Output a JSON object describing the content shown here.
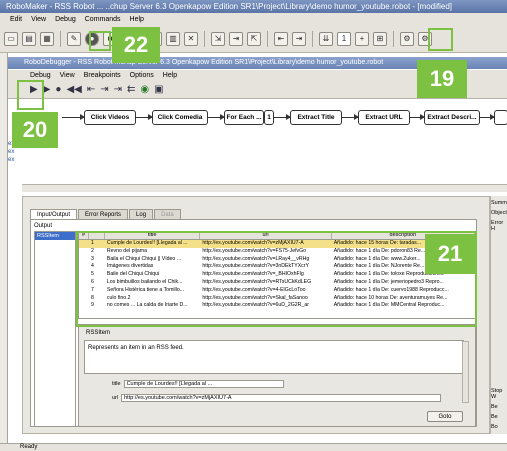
{
  "window": {
    "title": "RoboMaker - RSS Robot ...  ..chup Server 6.3 Openkapow Edition SR1\\Project\\Library\\demo  humor_youtube.robot  - [modified]"
  },
  "menu": [
    "Edit",
    "View",
    "Debug",
    "Commands",
    "Help"
  ],
  "debugger": {
    "title": "RoboDebugger - RSS Robot ...chup Server 6.3 Openkapow Edition SR1\\Project\\Library\\demo  humor_youtube.robot",
    "menu": [
      "Debug",
      "View",
      "Breakpoints",
      "Options",
      "Help"
    ]
  },
  "flow_steps": [
    "Click Videos",
    "Click Comedia",
    "For Each ...",
    "1",
    "Extract Title",
    "Extract URL",
    "Extract Descri..."
  ],
  "callouts": {
    "c19": "19",
    "c20": "20",
    "c21": "21",
    "c22": "22"
  },
  "accent_color": "#7dc142",
  "left_strip_text": [
    "ex.",
    "ex",
    "ex"
  ],
  "tabs": [
    "Input/Output",
    "Error Reports",
    "Log",
    "Data"
  ],
  "output": {
    "label": "Output",
    "list": [
      "RSSItem"
    ]
  },
  "table": {
    "columns": [
      "#",
      "title",
      "url",
      "description"
    ],
    "rows": [
      [
        "1",
        "Cumple de Lourdes!! [Llegada al ...",
        "http://es.youtube.com/watch?v=zMjAXIU7-A",
        "Añadido: hace 15 horas De: taradas..."
      ],
      [
        "2",
        "Revno del pijama",
        "http://es.youtube.com/watch?v=FS75-JefvGo",
        "Añadido: hace 1 día De: pdoron83 Re..."
      ],
      [
        "3",
        "Baila el Chiqui Chiqui || Vídeo ...",
        "http://es.youtube.com/watch?v=LRay4__vRHg",
        "Añadido: hace 1 día De: www.Zuker..."
      ],
      [
        "4",
        "Imágenes divertidas",
        "http://es.youtube.com/watch?v=3nDEkTYXcrY",
        "Añadido: hace 1 día De: NJorente Re..."
      ],
      [
        "5",
        "Baile del Chiqui Chiqui",
        "http://es.youtube.com/watch?v=_BHIOxhFlg",
        "Añadido: hace 1 día De: toloxe Reproducciones"
      ],
      [
        "6",
        "Los bimbuillos bailando el Chik...",
        "http://es.youtube.com/watch?v=RTsUCkKdLEG",
        "Añadido: hace 1 día De: jemeriopedro3 Repro..."
      ],
      [
        "7",
        "Señora Histérica tiene a Tomillo...",
        "http://es.youtube.com/watch?v=4-ElGcLoToo",
        "Añadido: hace 1 día De: cuervo1988 Reproducc..."
      ],
      [
        "8",
        "culo fino.2",
        "http://es.youtube.com/watch?v=Skal_faSanoo",
        "Añadido: hace 10 horas De: aventuramuyes Re..."
      ],
      [
        "9",
        "no comes ... La calda de Iriarte D...",
        "http://es.youtube.com/watch?v=6uD_2G2R_ar",
        "Añadido: hace 1 día De: MMCentral Reproduc..."
      ]
    ]
  },
  "detail": {
    "label": "RSSItem",
    "description": "Represents an item in an RSS feed.",
    "fields": [
      {
        "name": "title",
        "value": "Cumple de Lourdes!! [Llegada al ..."
      },
      {
        "name": "url",
        "value": "http://es.youtube.com/watch?v=zMjAXIU7-A"
      }
    ],
    "go_button": "Goto"
  },
  "right_panel": [
    "Summ",
    "Object",
    "Error H",
    "Stop W",
    "Be",
    "Be",
    "Bo"
  ],
  "status": "Ready"
}
